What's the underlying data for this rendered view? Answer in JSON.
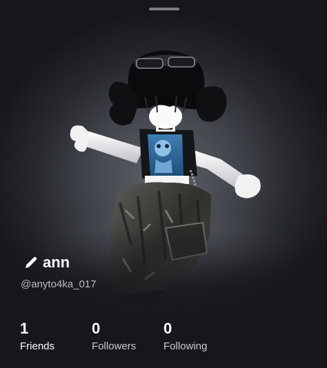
{
  "profile": {
    "display_name": "ann",
    "username": "@anyto4ka_017"
  },
  "stats": [
    {
      "count": "1",
      "label": "Friends"
    },
    {
      "count": "0",
      "label": "Followers"
    },
    {
      "count": "0",
      "label": "Following"
    }
  ],
  "icons": {
    "edit": "pencil-icon",
    "handle": "drag-handle"
  },
  "colors": {
    "background": "#16171b",
    "text_primary": "#ffffff",
    "text_secondary": "#b9bcc2"
  }
}
